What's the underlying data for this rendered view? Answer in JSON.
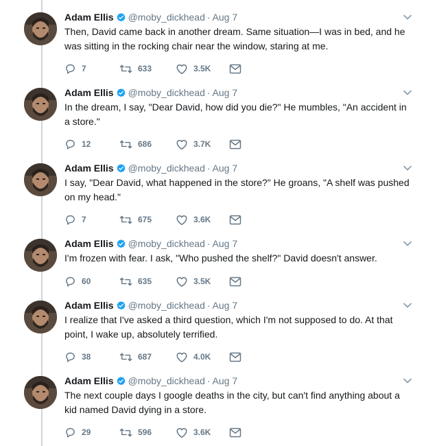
{
  "tweets": [
    {
      "name": "Adam Ellis",
      "handle": "@moby_dickhead",
      "date": "Aug 7",
      "text": "Then, David came back in another dream. Same situation—I was in bed, and he was sitting in the rocking chair near the window, staring at me.",
      "replies": "7",
      "retweets": "633",
      "likes": "3.5K"
    },
    {
      "name": "Adam Ellis",
      "handle": "@moby_dickhead",
      "date": "Aug 7",
      "text": "In the dream, I say, \"Dear David, how did you die?\" He mumbles, \"An accident in a store.\"",
      "replies": "12",
      "retweets": "686",
      "likes": "3.7K"
    },
    {
      "name": "Adam Ellis",
      "handle": "@moby_dickhead",
      "date": "Aug 7",
      "text": "I say, \"Dear David, what happened in the store?\" He groans, \"A shelf was pushed on my head.\"",
      "replies": "7",
      "retweets": "675",
      "likes": "3.6K"
    },
    {
      "name": "Adam Ellis",
      "handle": "@moby_dickhead",
      "date": "Aug 7",
      "text": "I'm frozen with fear. I ask, \"Who pushed the shelf?\" David doesn't answer.",
      "replies": "60",
      "retweets": "635",
      "likes": "3.5K"
    },
    {
      "name": "Adam Ellis",
      "handle": "@moby_dickhead",
      "date": "Aug 7",
      "text": "I realize that I've asked a third question, which I'm not supposed to do. At that point, I wake up, absolutely terrified.",
      "replies": "38",
      "retweets": "687",
      "likes": "4.0K"
    },
    {
      "name": "Adam Ellis",
      "handle": "@moby_dickhead",
      "date": "Aug 7",
      "text": "The next couple days I google deaths in the city, but can't find anything about a kid named David dying in a store.",
      "replies": "29",
      "retweets": "596",
      "likes": "3.6K"
    }
  ],
  "icons": {
    "verified": "verified-badge-icon",
    "menu": "chevron-down-icon",
    "reply": "reply-icon",
    "retweet": "retweet-icon",
    "like": "heart-icon",
    "dm": "envelope-icon"
  },
  "colors": {
    "verified": "#1da1f2",
    "muted": "#657786",
    "thread_line": "#ccd6dd",
    "text": "#14171a"
  }
}
